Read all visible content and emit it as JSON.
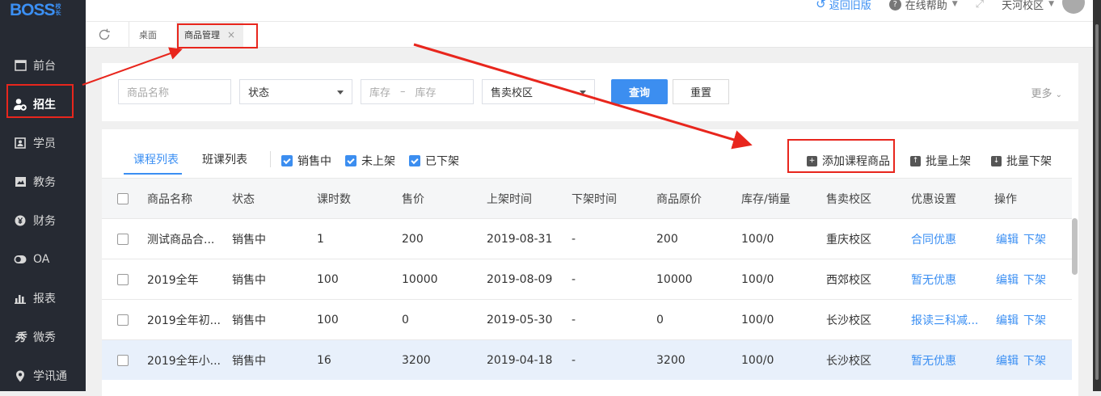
{
  "app": {
    "logo": "BOSS",
    "logo_badge": "校长"
  },
  "sidebar": {
    "items": [
      {
        "label": "前台",
        "icon": "calendar-icon"
      },
      {
        "label": "招生",
        "icon": "add-user-icon",
        "active": true
      },
      {
        "label": "学员",
        "icon": "id-card-icon"
      },
      {
        "label": "教务",
        "icon": "book-icon"
      },
      {
        "label": "财务",
        "icon": "yen-icon"
      },
      {
        "label": "OA",
        "icon": "toggle-icon"
      },
      {
        "label": "报表",
        "icon": "bar-chart-icon"
      },
      {
        "label": "微秀",
        "icon": "weixiu-icon"
      },
      {
        "label": "学讯通",
        "icon": "location-icon"
      }
    ]
  },
  "topbar": {
    "back_old": "返回旧版",
    "help": "在线帮助",
    "campus": "天河校区"
  },
  "tabs": {
    "desktop": "桌面",
    "active": "商品管理",
    "close": "×"
  },
  "filters": {
    "product_name_placeholder": "商品名称",
    "status_placeholder": "状态",
    "stock_from_placeholder": "库存",
    "stock_dash": "–",
    "stock_to_placeholder": "库存",
    "campus_placeholder": "售卖校区",
    "query": "查询",
    "reset": "重置",
    "more": "更多"
  },
  "list": {
    "tabs": [
      "课程列表",
      "班课列表"
    ],
    "checks": [
      "销售中",
      "未上架",
      "已下架"
    ],
    "actions": {
      "add": "添加课程商品",
      "batch_on": "批量上架",
      "batch_off": "批量下架"
    },
    "columns": [
      "商品名称",
      "状态",
      "课时数",
      "售价",
      "上架时间",
      "下架时间",
      "商品原价",
      "库存/销量",
      "售卖校区",
      "优惠设置",
      "操作"
    ],
    "rows": [
      {
        "name": "测试商品合...",
        "status": "销售中",
        "hours": "1",
        "price": "200",
        "on": "2019-08-31",
        "off": "-",
        "orig": "200",
        "stock": "100/0",
        "campus": "重庆校区",
        "discount": "合同优惠",
        "edit": "编辑",
        "down": "下架"
      },
      {
        "name": "2019全年",
        "status": "销售中",
        "hours": "100",
        "price": "10000",
        "on": "2019-08-09",
        "off": "-",
        "orig": "10000",
        "stock": "100/0",
        "campus": "西郊校区",
        "discount": "暂无优惠",
        "edit": "编辑",
        "down": "下架"
      },
      {
        "name": "2019全年初...",
        "status": "销售中",
        "hours": "100",
        "price": "0",
        "on": "2019-05-30",
        "off": "-",
        "orig": "0",
        "stock": "100/0",
        "campus": "长沙校区",
        "discount": "报读三科减...",
        "edit": "编辑",
        "down": "下架"
      },
      {
        "name": "2019全年小...",
        "status": "销售中",
        "hours": "16",
        "price": "3200",
        "on": "2019-04-18",
        "off": "-",
        "orig": "3200",
        "stock": "100/0",
        "campus": "长沙校区",
        "discount": "暂无优惠",
        "edit": "编辑",
        "down": "下架"
      }
    ]
  },
  "colors": {
    "accent": "#3b8ff3",
    "sidebar": "#262a33",
    "annotation": "#e8261d"
  }
}
